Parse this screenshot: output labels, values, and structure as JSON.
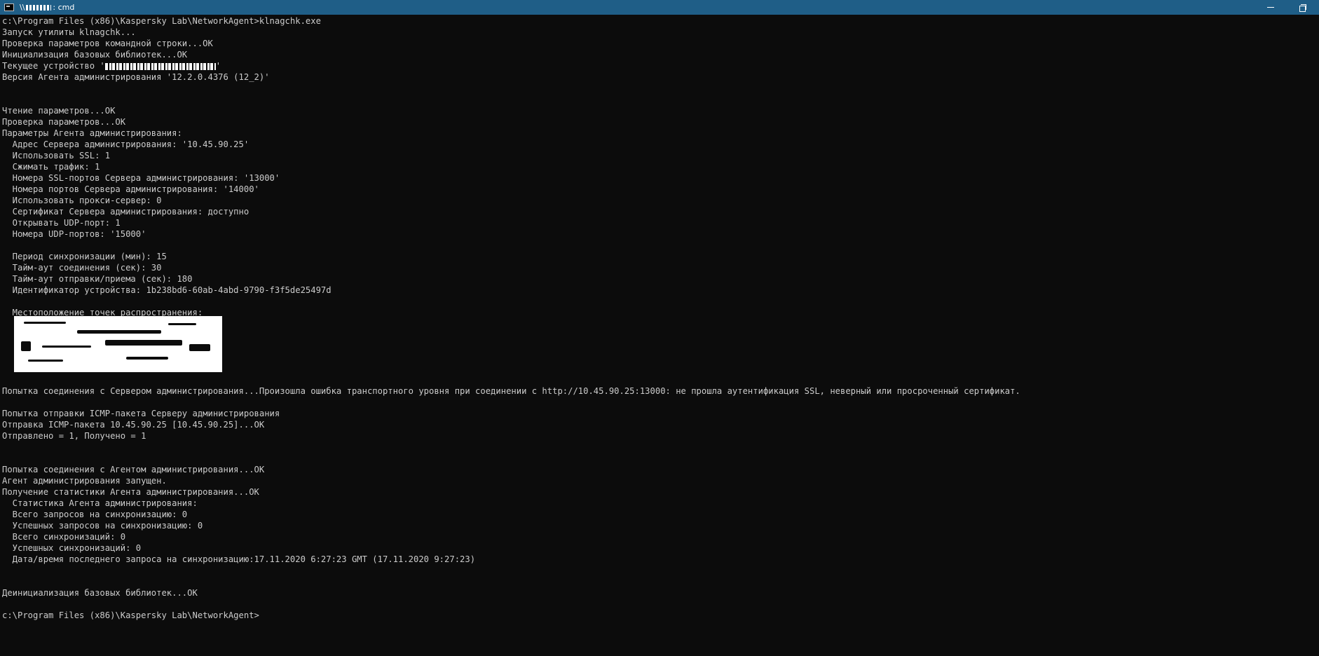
{
  "window": {
    "title_prefix": "\\\\",
    "title_suffix": ": cmd",
    "colors": {
      "titlebar": "#1f5e87",
      "console_bg": "#0c0c0c",
      "console_fg": "#cccccc"
    },
    "icons": [
      "console-app-icon",
      "minimize-icon",
      "restore-icon"
    ]
  },
  "console": {
    "lines": [
      "c:\\Program Files (x86)\\Kaspersky Lab\\NetworkAgent>klnagchk.exe",
      "Запуск утилиты klnagchk...",
      "Проверка параметров командной строки...OK",
      "Инициализация базовых библиотек...OK",
      "Текущее устройство '",
      "Версия Агента администрирования '12.2.0.4376 (12_2)'",
      "",
      "",
      "Чтение параметров...OK",
      "Проверка параметров...OK",
      "Параметры Агента администрирования:",
      "  Адрес Сервера администрирования: '10.45.90.25'",
      "  Использовать SSL: 1",
      "  Сжимать трафик: 1",
      "  Номера SSL-портов Сервера администрирования: '13000'",
      "  Номера портов Сервера администрирования: '14000'",
      "  Использовать прокси-сервер: 0",
      "  Сертификат Сервера администрирования: доступно",
      "  Открывать UDP-порт: 1",
      "  Номера UDP-портов: '15000'",
      "",
      "  Период синхронизации (мин): 15",
      "  Тайм-аут соединения (сек): 30",
      "  Тайм-аут отправки/приема (сек): 180",
      "  Идентификатор устройства: 1b238bd6-60ab-4abd-9790-f3f5de25497d",
      "",
      "  Местоположение точек распространения:",
      "",
      "",
      "",
      "",
      "",
      "",
      "Попытка соединения с Сервером администрирования...Произошла ошибка транспортного уровня при соединении с http://10.45.90.25:13000: не прошла аутентификация SSL, неверный или просроченный сертификат.",
      "",
      "Попытка отправки ICMP-пакета Серверу администрирования",
      "Отправка ICMP-пакета 10.45.90.25 [10.45.90.25]...OK",
      "Отправлено = 1, Получено = 1",
      "",
      "",
      "Попытка соединения с Агентом администрирования...OK",
      "Агент администрирования запущен.",
      "Получение статистики Агента администрирования...OK",
      "  Статистика Агента администрирования:",
      "  Всего запросов на синхронизацию: 0",
      "  Успешных запросов на синхронизацию: 0",
      "  Всего синхронизаций: 0",
      "  Успешных синхронизаций: 0",
      "  Дата/время последнего запроса на синхронизацию:17.11.2020 6:27:23 GMT (17.11.2020 9:27:23)",
      "",
      "",
      "Деинициализация базовых библиотек...OK",
      "",
      "c:\\Program Files (x86)\\Kaspersky Lab\\NetworkAgent>"
    ],
    "device_line_suffix": "'"
  }
}
